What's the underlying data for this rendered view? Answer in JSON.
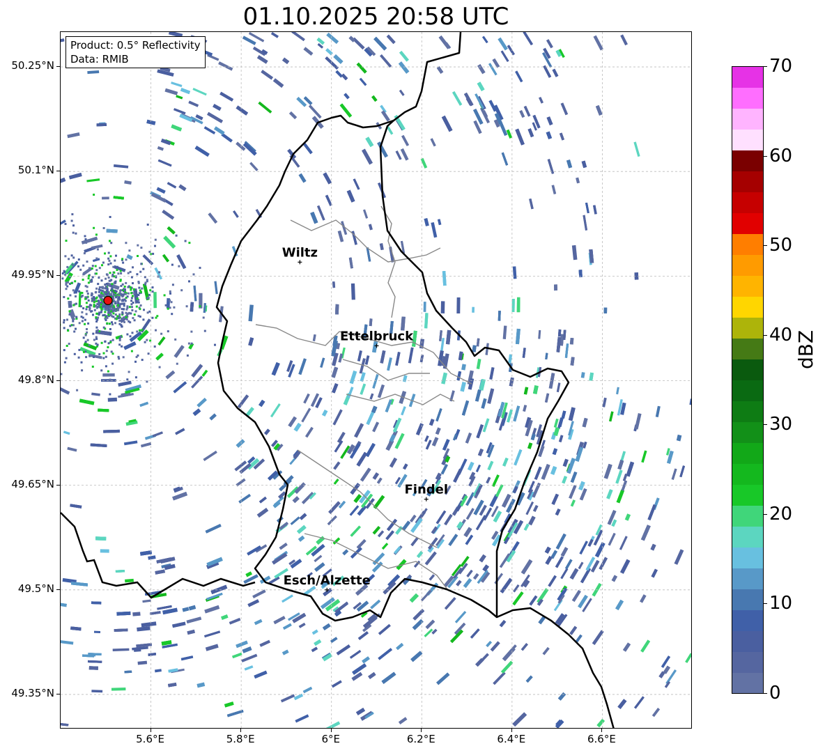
{
  "title": "01.10.2025 20:58 UTC",
  "info": {
    "product": "Product: 0.5° Reflectivity",
    "data": "Data: RMIB"
  },
  "axes": {
    "lat_ticks": [
      "50.25°N",
      "50.1°N",
      "49.95°N",
      "49.8°N",
      "49.65°N",
      "49.5°N",
      "49.35°N"
    ],
    "lon_ticks": [
      "5.6°E",
      "5.8°E",
      "6°E",
      "6.2°E",
      "6.4°E",
      "6.6°E"
    ]
  },
  "colorbar": {
    "unit": "dBZ",
    "ticks": [
      "0",
      "10",
      "20",
      "30",
      "40",
      "50",
      "60",
      "70"
    ],
    "colors": [
      "#6272a4",
      "#5566a0",
      "#4a5fa0",
      "#4060a8",
      "#4878b0",
      "#5899c8",
      "#68c0e0",
      "#5cd6c0",
      "#40d67a",
      "#18c828",
      "#14b81e",
      "#12a818",
      "#129018",
      "#0e7c14",
      "#0a6a12",
      "#0a5a0e",
      "#457a15",
      "#adb40a",
      "#ffd600",
      "#ffb400",
      "#ff9b00",
      "#ff7e00",
      "#e10000",
      "#c60000",
      "#a50000",
      "#7a0000",
      "#ffe0ff",
      "#ffb4ff",
      "#ff6eff",
      "#e632e6"
    ]
  },
  "places": [
    {
      "name": "Wiltz",
      "lat": 49.97,
      "lon": 5.93
    },
    {
      "name": "Ettelbruck",
      "lat": 49.85,
      "lon": 6.1
    },
    {
      "name": "Findel",
      "lat": 49.63,
      "lon": 6.21
    },
    {
      "name": "Esch/Alzette",
      "lat": 49.5,
      "lon": 5.99
    }
  ],
  "radar_site": {
    "lat": 49.915,
    "lon": 5.505,
    "color": "#e81010"
  },
  "colors": {
    "border": "#000000",
    "canton": "#888888",
    "grid": "#bbbbbb"
  }
}
